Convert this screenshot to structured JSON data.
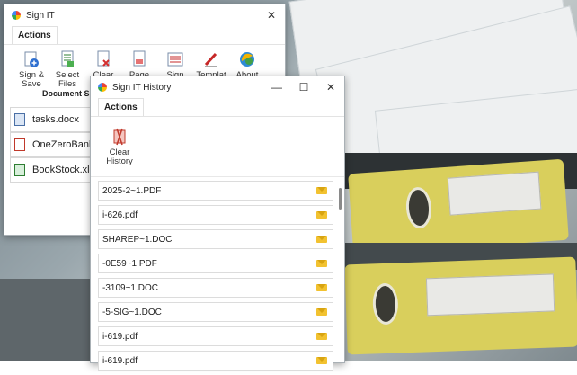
{
  "main_window": {
    "title": "Sign IT",
    "tab": "Actions",
    "buttons": [
      {
        "line1": "Sign &",
        "line2": "Save"
      },
      {
        "line1": "Select",
        "line2": "Files"
      },
      {
        "line1": "Clear",
        "line2": ""
      },
      {
        "line1": "Page",
        "line2": ""
      },
      {
        "line1": "Sign",
        "line2": ""
      },
      {
        "line1": "Templat",
        "line2": ""
      },
      {
        "line1": "About",
        "line2": ""
      }
    ],
    "group_label": "Document Sig",
    "files": [
      {
        "name": "tasks.docx",
        "type": "doc"
      },
      {
        "name": "OneZeroBankAg",
        "type": "pdf"
      },
      {
        "name": "BookStock.xlsx",
        "type": "xls"
      }
    ]
  },
  "history_window": {
    "title": "Sign IT History",
    "tab": "Actions",
    "clear_button": {
      "line1": "Clear",
      "line2": "History"
    },
    "items": [
      "2025-2~1.PDF",
      "i-626.pdf",
      "SHAREP~1.DOC",
      "-0E59~1.PDF",
      "-3109~1.DOC",
      "-5-SIG~1.DOC",
      "i-619.pdf",
      "i-619.pdf"
    ]
  },
  "colors": {
    "envelope": "#f2c230",
    "binder": "#d9cf5c"
  }
}
